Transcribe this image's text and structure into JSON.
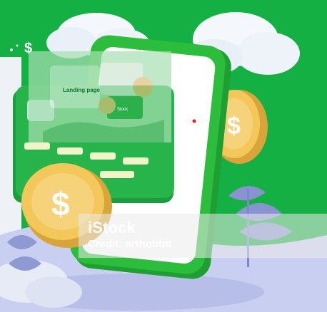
{
  "watermark": {
    "brand": "iStock",
    "credit": "Credit: arthobbit"
  },
  "inset": {
    "title": "Landing page",
    "subtitle": "Stock"
  },
  "colors": {
    "background_green": "#1bb34a",
    "phone_green": "#23b33c",
    "coin_gold": "#f2c14e",
    "cloud": "#f4f7fb",
    "leaf": "#8a95cf"
  },
  "icons": [
    "dollar-sign-icon",
    "coin-icon",
    "phone-icon",
    "credit-card-icon",
    "cloud-icon",
    "leaf-icon"
  ]
}
